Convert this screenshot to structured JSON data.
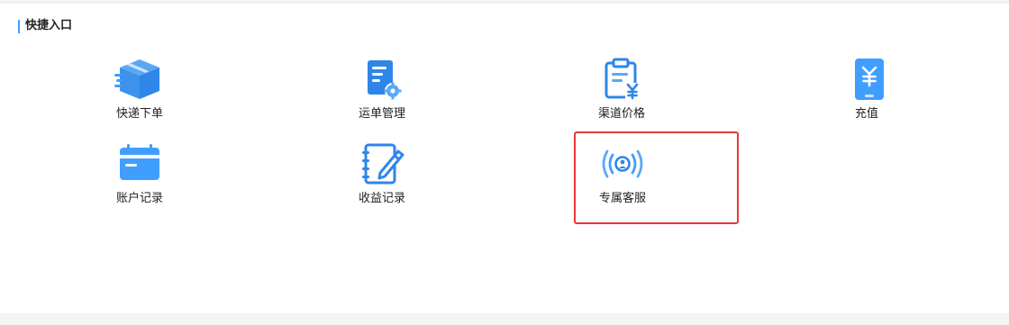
{
  "section": {
    "title": "快捷入口"
  },
  "tiles": [
    {
      "label": "快递下单",
      "icon": "package-box-icon"
    },
    {
      "label": "运单管理",
      "icon": "document-gear-icon"
    },
    {
      "label": "渠道价格",
      "icon": "clipboard-yen-icon"
    },
    {
      "label": "充值",
      "icon": "mobile-yuan-icon"
    },
    {
      "label": "账户记录",
      "icon": "calendar-card-icon"
    },
    {
      "label": "收益记录",
      "icon": "notebook-pen-icon"
    },
    {
      "label": "专属客服",
      "icon": "user-broadcast-icon"
    }
  ],
  "colors": {
    "accent": "#409eff",
    "icon_dark": "#2f86e8",
    "icon_light": "#5aa8f5",
    "highlight": "#e53935",
    "panel_bg": "#ffffff",
    "page_bg": "#f4f4f5"
  }
}
